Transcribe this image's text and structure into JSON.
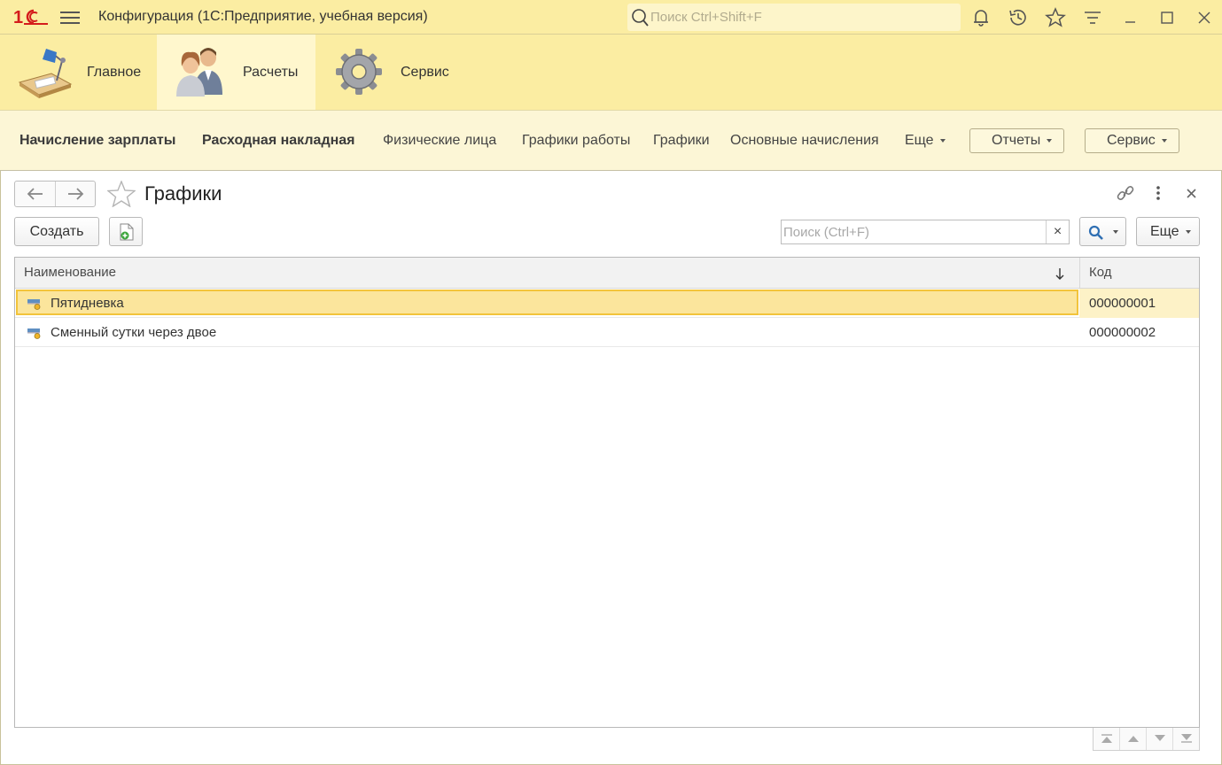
{
  "titlebar": {
    "app_title": "Конфигурация  (1С:Предприятие, учебная версия)",
    "search_placeholder": "Поиск Ctrl+Shift+F",
    "icons": [
      "bell-icon",
      "history-icon",
      "star-icon",
      "settings-lines-icon",
      "minimize-icon",
      "maximize-icon",
      "close-icon"
    ]
  },
  "sections": [
    {
      "label": "Главное",
      "icon": "desk-lamp-icon",
      "active": false
    },
    {
      "label": "Расчеты",
      "icon": "people-icon",
      "active": true
    },
    {
      "label": "Сервис",
      "icon": "gear-icon",
      "active": false
    }
  ],
  "functions": {
    "links": [
      {
        "label": "Начисление зарплаты",
        "bold": true
      },
      {
        "label": "Расходная накладная",
        "bold": true
      },
      {
        "label": "Физические лица",
        "bold": false
      },
      {
        "label": "Графики работы",
        "bold": false
      },
      {
        "label": "Графики",
        "bold": false
      },
      {
        "label": "Основные начисления",
        "bold": false
      }
    ],
    "more_label": "Еще",
    "reports_label": "Отчеты",
    "service_label": "Сервис"
  },
  "form": {
    "title": "Графики",
    "create_label": "Создать",
    "search_placeholder": "Поиск (Ctrl+F)",
    "clear_symbol": "×",
    "more_label": "Еще"
  },
  "table": {
    "columns": [
      "Наименование",
      "Код"
    ],
    "rows": [
      {
        "name": "Пятидневка",
        "code": "000000001",
        "selected": true
      },
      {
        "name": "Сменный сутки через двое",
        "code": "000000002",
        "selected": false
      }
    ]
  },
  "colors": {
    "panel_yellow": "#fbeda2",
    "selection": "#fbe59c",
    "selection_border": "#f2c43b"
  }
}
